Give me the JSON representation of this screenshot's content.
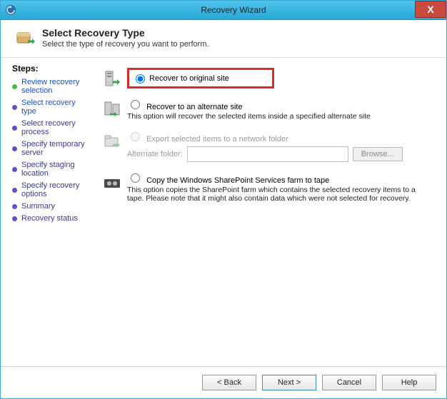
{
  "window": {
    "title": "Recovery Wizard"
  },
  "header": {
    "title": "Select Recovery Type",
    "subtitle": "Select the type of recovery you want to perform."
  },
  "sidebar": {
    "title": "Steps:",
    "items": [
      {
        "label": "Review recovery selection",
        "state": "done"
      },
      {
        "label": "Select recovery type",
        "state": "current"
      },
      {
        "label": "Select recovery process",
        "state": "pending"
      },
      {
        "label": "Specify temporary server",
        "state": "pending"
      },
      {
        "label": "Specify staging location",
        "state": "pending"
      },
      {
        "label": "Specify recovery options",
        "state": "pending"
      },
      {
        "label": "Summary",
        "state": "pending"
      },
      {
        "label": "Recovery status",
        "state": "pending"
      }
    ]
  },
  "options": {
    "original": {
      "label": "Recover to original site"
    },
    "alternate": {
      "label": "Recover to an alternate site",
      "desc": "This option will recover the selected items inside a specified alternate site"
    },
    "export": {
      "label": "Export selected items to a network folder",
      "altFolderLabel": "Alternate folder:",
      "browse": "Browse..."
    },
    "tape": {
      "label": "Copy the Windows SharePoint Services farm to tape",
      "desc": "This option copies the SharePoint farm which contains the selected recovery items to a tape. Please note that it might also contain data which were not selected for recovery."
    }
  },
  "buttons": {
    "back": "< Back",
    "next": "Next >",
    "cancel": "Cancel",
    "help": "Help"
  }
}
